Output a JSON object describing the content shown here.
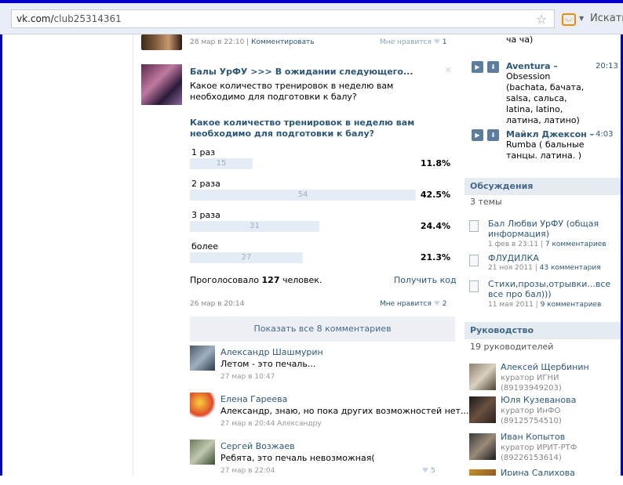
{
  "browser": {
    "url_domain": "vk.com/",
    "url_path": "club25314361",
    "search_label": "Искать"
  },
  "post_top": {
    "date": "28 мар в 22:10",
    "comment_link": "Комментировать",
    "likes_label": "Мне нравится",
    "likes_count": "1"
  },
  "post": {
    "title": "Балы УрФУ >>> В ожидании следующего...",
    "text": "Какое количество тренировок в неделю вам необходимо для подготовки к балу?",
    "close": "×"
  },
  "poll": {
    "question": "Какое количество тренировок в неделю вам необходимо для подготовки к балу?",
    "options": [
      {
        "label": "1 раз",
        "count": "15",
        "percent": "11.8%",
        "fraction": 0.118
      },
      {
        "label": "2 раза",
        "count": "54",
        "percent": "42.5%",
        "fraction": 0.425
      },
      {
        "label": "3 раза",
        "count": "31",
        "percent": "24.4%",
        "fraction": 0.244
      },
      {
        "label": "более",
        "count": "27",
        "percent": "21.3%",
        "fraction": 0.213
      }
    ],
    "voted_prefix": "Проголосовало",
    "voted_count": "127",
    "voted_suffix": "человек.",
    "get_code": "Получить код",
    "date": "26 мар в 20:14",
    "likes_label": "Мне нравится",
    "likes_count": "2",
    "show_all": "Показать все 8 комментариев"
  },
  "comments": [
    {
      "name": "Александр Шашмурин",
      "text": "Летом - это печаль...",
      "date": "27 мар в 10:47",
      "likes": ""
    },
    {
      "name": "Елена Гареева",
      "text": "Александр, знаю, но пока других возможностей нет...",
      "date": "27 мар в 20:44 Александру",
      "likes": ""
    },
    {
      "name": "Сергей Возжаев",
      "text": "Ребята, это печаль невозможная(",
      "date": "27 мар в 22:04",
      "likes": "5"
    }
  ],
  "audio": {
    "prev_tail": "ча ча)",
    "tracks": [
      {
        "artist": "Aventura –",
        "title": "Obsession (bachata, бачата, salsa, сальса, latina, latino, латина, латино)",
        "duration": "20:13"
      },
      {
        "artist": "Майкл Джексон –",
        "title": "Rumba ( бальные танцы. латина. )",
        "duration": "4:03"
      }
    ]
  },
  "discussions": {
    "header": "Обсуждения",
    "count": "3 темы",
    "items": [
      {
        "title": "Бал Любви УрФУ (общая информация)",
        "meta": "1 фев в 23:11",
        "comments": "7 комментариев"
      },
      {
        "title": "ФЛУДИЛКА",
        "meta": "21 ноя 2011",
        "comments": "43 комментария"
      },
      {
        "title": "Стихи,прозы,отрывки...все все про бал)))",
        "meta": "11 мая 2011",
        "comments": "9 комментариев"
      }
    ]
  },
  "leaders": {
    "header": "Руководство",
    "count": "19 руководителей",
    "items": [
      {
        "name": "Алексей Щербинин",
        "role": "куратор ИГНИ (89193949203)"
      },
      {
        "name": "Юля Кузеванова",
        "role": "куратор ИнФО (89125754510)"
      },
      {
        "name": "Иван Копытов",
        "role": "куратор ИРИТ-РТФ (89226153614)"
      },
      {
        "name": "Ирина Салихова",
        "role": ""
      }
    ]
  }
}
